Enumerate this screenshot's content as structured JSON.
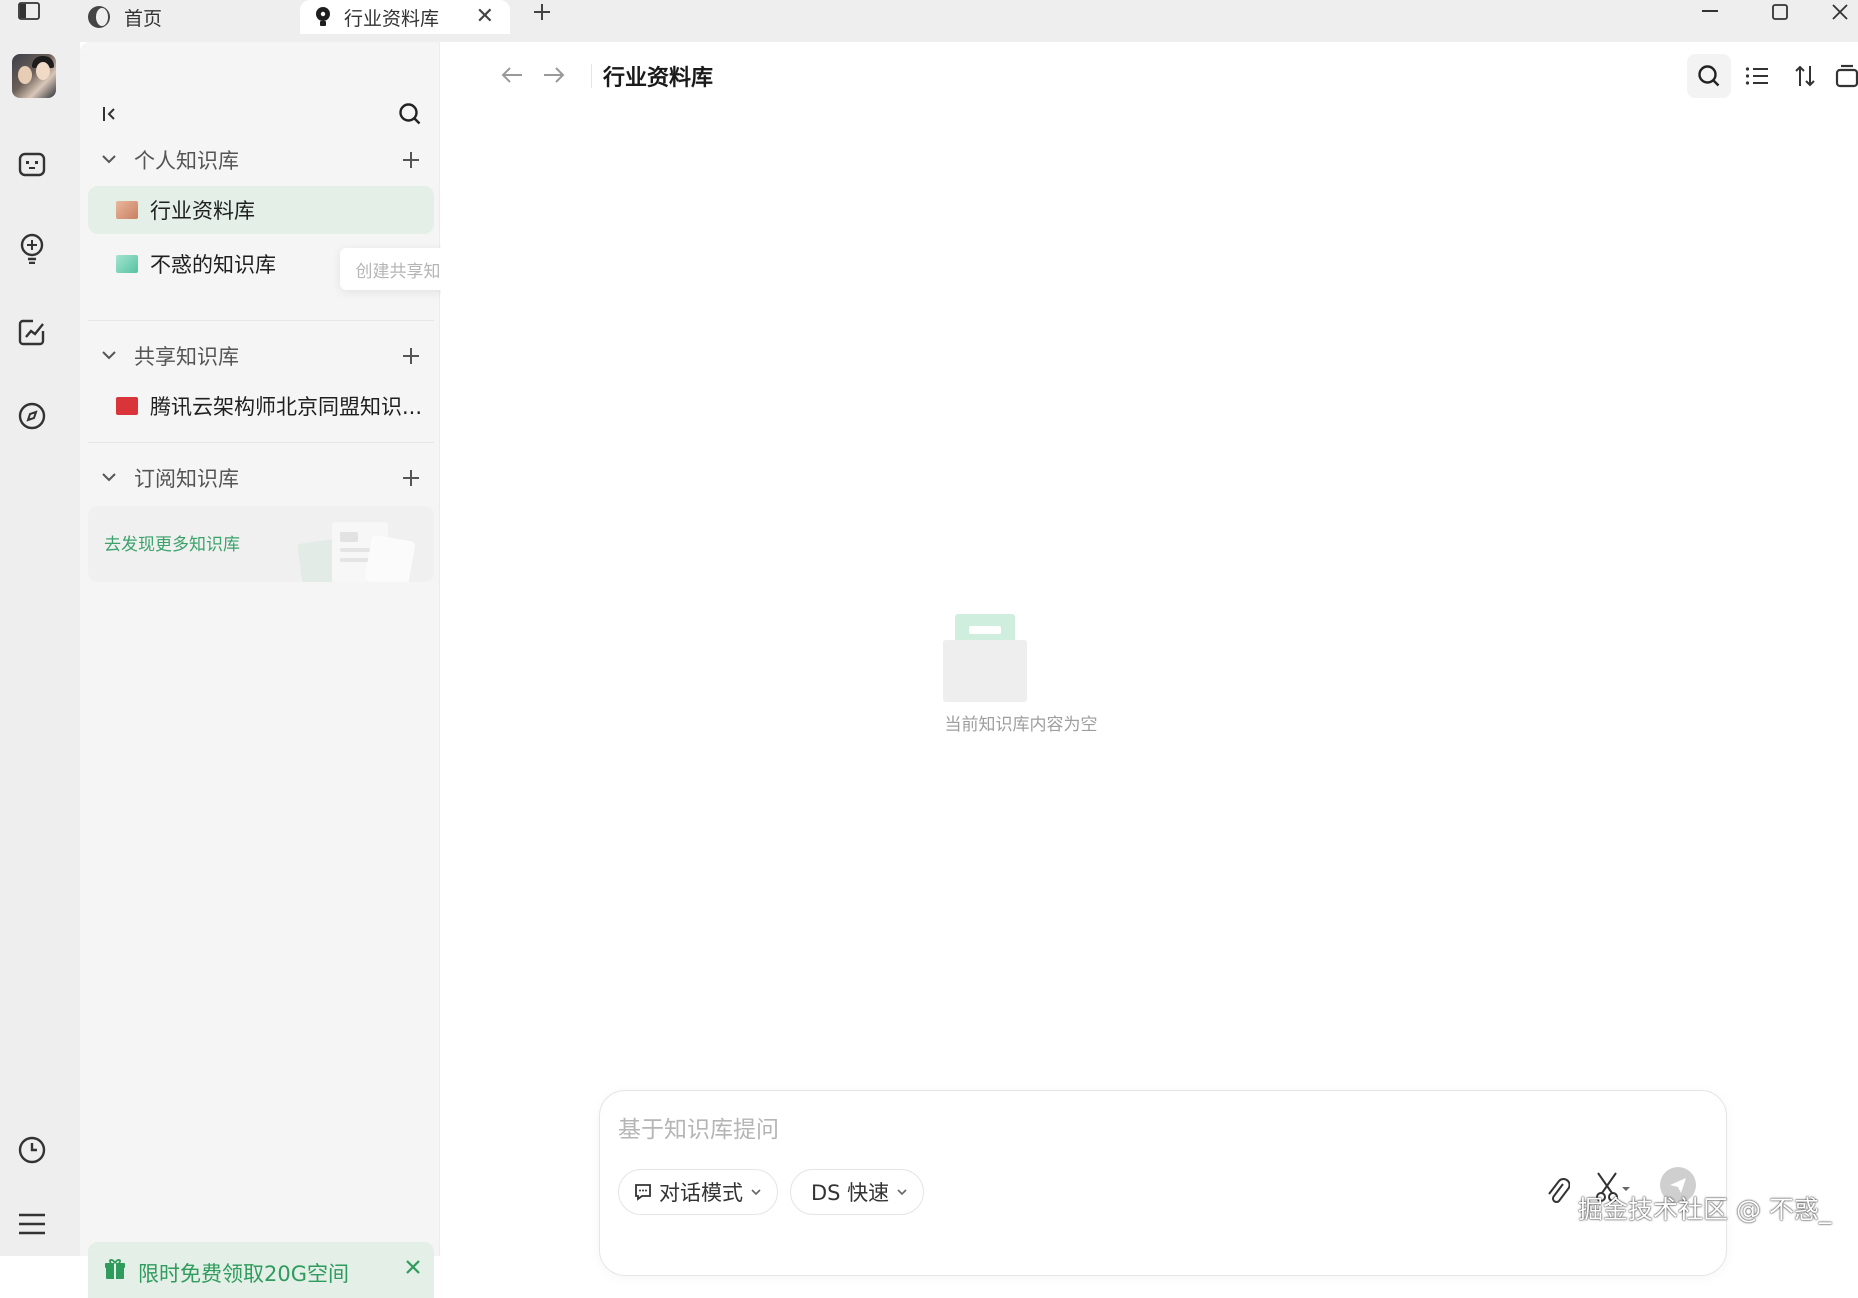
{
  "titlebar": {
    "tabs": [
      {
        "label": "首页"
      },
      {
        "label": "行业资料库"
      }
    ]
  },
  "sidebar": {
    "sections": [
      {
        "label": "个人知识库",
        "items": [
          {
            "label": "行业资料库",
            "selected": true,
            "icon_color": "#d9a58b"
          },
          {
            "label": "不惑的知识库",
            "selected": false,
            "icon_color": "#7dd3b8"
          }
        ]
      },
      {
        "label": "共享知识库",
        "items": [
          {
            "label": "腾讯云架构师北京同盟知识...",
            "selected": false,
            "icon_color": "#d8343a"
          }
        ]
      },
      {
        "label": "订阅知识库",
        "items": []
      }
    ],
    "tooltip": "创建共享知识库",
    "discover_label": "去发现更多知识库",
    "promo_label": "限时免费领取20G空间"
  },
  "main": {
    "title": "行业资料库",
    "empty_text": "当前知识库内容为空",
    "composer": {
      "placeholder": "基于知识库提问",
      "mode_label": "对话模式",
      "model_label": "DS 快速"
    }
  },
  "watermark": "掘金技术社区 @ 不惑_",
  "colors": {
    "accent": "#2f9b5c",
    "selected_bg": "#e3efe7",
    "rail_bg": "#eeeeee",
    "sidebar_bg": "#f5f5f5"
  }
}
